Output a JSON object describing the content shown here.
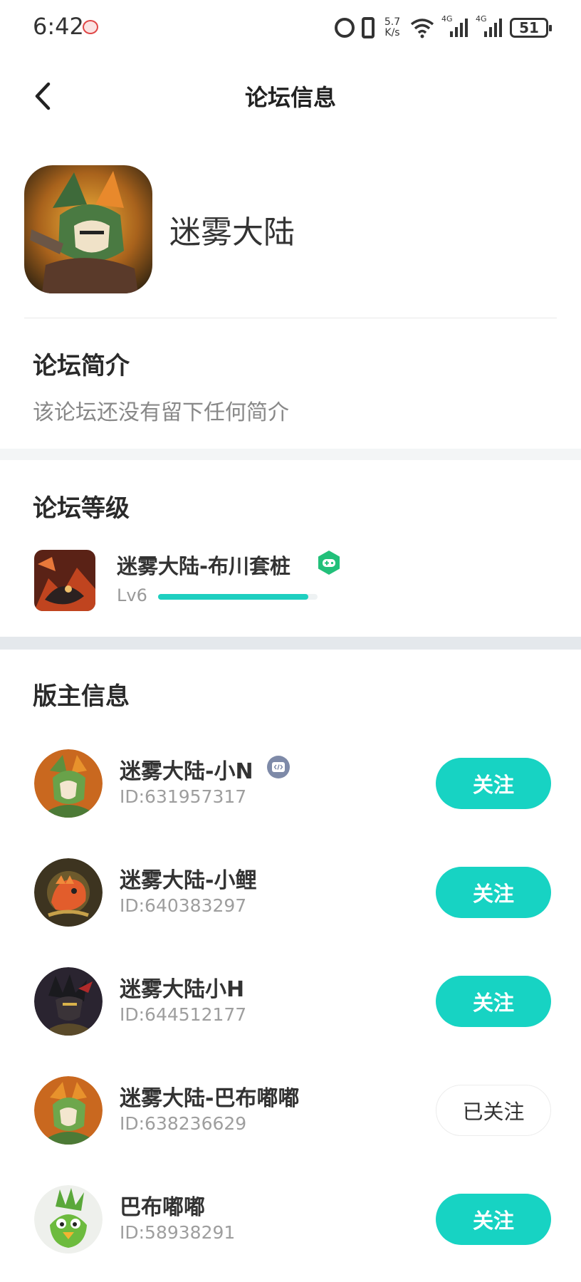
{
  "status_bar": {
    "time": "6:42",
    "net_speed_value": "5.7",
    "net_speed_unit": "K/s",
    "battery": "51",
    "signal_label_1": "4G",
    "signal_label_2": "4G"
  },
  "nav": {
    "title": "论坛信息"
  },
  "forum": {
    "name": "迷雾大陆"
  },
  "intro": {
    "title": "论坛简介",
    "text": "该论坛还没有留下任何简介"
  },
  "level": {
    "title": "论坛等级",
    "name": "迷雾大陆-布川套桩",
    "lv": "Lv6",
    "progress": 0.94
  },
  "moderators": {
    "title": "版主信息",
    "items": [
      {
        "name": "迷雾大陆-小N",
        "id": "ID:631957317",
        "follow_label": "关注",
        "followed": false,
        "dev_badge": true
      },
      {
        "name": "迷雾大陆-小鲤",
        "id": "ID:640383297",
        "follow_label": "关注",
        "followed": false,
        "dev_badge": false
      },
      {
        "name": "迷雾大陆小H",
        "id": "ID:644512177",
        "follow_label": "关注",
        "followed": false,
        "dev_badge": false
      },
      {
        "name": "迷雾大陆-巴布嘟嘟",
        "id": "ID:638236629",
        "follow_label": "已关注",
        "followed": true,
        "dev_badge": false
      },
      {
        "name": "巴布嘟嘟",
        "id": "ID:58938291",
        "follow_label": "关注",
        "followed": false,
        "dev_badge": false
      }
    ]
  },
  "colors": {
    "accent": "#17d3c3",
    "badge_green": "#22c07a",
    "badge_grey": "#7e8aa8"
  },
  "icons": {
    "back": "chevron-left-icon",
    "game_badge": "gamepad-icon",
    "dev_badge": "code-icon"
  }
}
